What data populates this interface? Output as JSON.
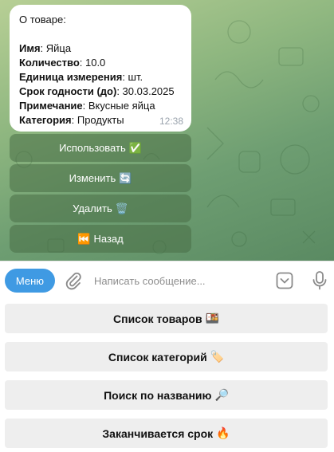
{
  "message": {
    "intro": "О товаре:",
    "fields": [
      {
        "label": "Имя",
        "value": ": Яйца"
      },
      {
        "label": "Количество",
        "value": ": 10.0"
      },
      {
        "label": "Единица измерения",
        "value": ": шт."
      },
      {
        "label": "Срок годности (до)",
        "value": ": 30.03.2025"
      },
      {
        "label": "Примечание",
        "value": ": Вкусные яйца"
      },
      {
        "label": "Категория",
        "value": ": Продукты"
      }
    ],
    "time": "12:38"
  },
  "inline_buttons": [
    {
      "label": "Использовать",
      "emoji": "✅"
    },
    {
      "label": "Изменить",
      "emoji": "🔄"
    },
    {
      "label": "Удалить",
      "emoji": "🗑️"
    },
    {
      "label": "Назад",
      "emoji": "⏮️",
      "emoji_first": true
    }
  ],
  "composer": {
    "menu_label": "Меню",
    "placeholder": "Написать сообщение..."
  },
  "keyboard": [
    {
      "label": "Список товаров",
      "emoji": "🍱"
    },
    {
      "label": "Список категорий",
      "emoji": "🏷️"
    },
    {
      "label": "Поиск по названию",
      "emoji": "🔎"
    },
    {
      "label": "Заканчивается срок",
      "emoji": "🔥"
    }
  ],
  "colors": {
    "menu_button": "#3f9ae3",
    "chat_background": "#8fb780",
    "keyboard_button": "#eeeeee"
  },
  "icons": [
    "paperclip-icon",
    "sticker-icon",
    "microphone-icon"
  ]
}
